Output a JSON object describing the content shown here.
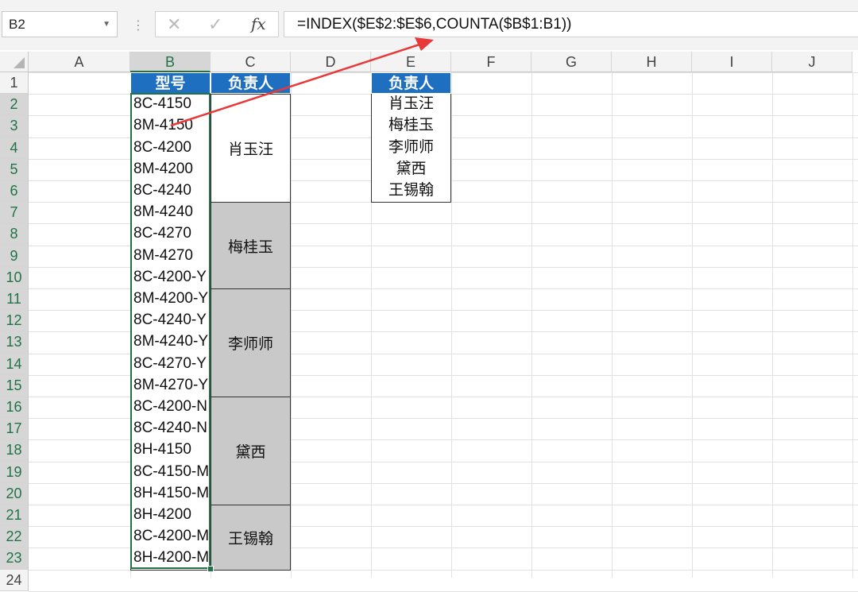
{
  "name_box": {
    "value": "B2",
    "dropdown_icon": "chevron-down-icon"
  },
  "formula_bar": {
    "cancel_icon": "cancel-x-icon",
    "enter_icon": "checkmark-icon",
    "fx_label": "fx",
    "formula": "=INDEX($E$2:$E$6,COUNTA($B$1:B1))"
  },
  "columns": [
    "A",
    "B",
    "C",
    "D",
    "E",
    "F",
    "G",
    "H",
    "I",
    "J"
  ],
  "rows": [
    "1",
    "2",
    "3",
    "4",
    "5",
    "6",
    "7",
    "8",
    "9",
    "10",
    "11",
    "12",
    "13",
    "14",
    "15",
    "16",
    "17",
    "18",
    "19",
    "20",
    "21",
    "22",
    "23",
    "24"
  ],
  "col_a": {
    "header": "型号",
    "values": [
      "8C-4150",
      "8M-4150",
      "8C-4200",
      "8M-4200",
      "8C-4240",
      "8M-4240",
      "8C-4270",
      "8M-4270",
      "8C-4200-Y",
      "8M-4200-Y",
      "8C-4240-Y",
      "8M-4240-Y",
      "8C-4270-Y",
      "8M-4270-Y",
      "8C-4200-N",
      "8C-4240-N",
      "8H-4150",
      "8C-4150-M",
      "8H-4150-M",
      "8H-4200",
      "8C-4200-M",
      "8H-4200-M"
    ]
  },
  "col_b": {
    "header": "负责人",
    "merged": [
      {
        "label": "肖玉汪",
        "rows": 5
      },
      {
        "label": "梅桂玉",
        "rows": 4
      },
      {
        "label": "李师师",
        "rows": 5
      },
      {
        "label": "黛西",
        "rows": 5
      },
      {
        "label": "王锡翰",
        "rows": 3
      }
    ]
  },
  "col_e": {
    "header": "负责人",
    "values": [
      "肖玉汪",
      "梅桂玉",
      "李师师",
      "黛西",
      "王锡翰"
    ]
  },
  "colors": {
    "header_fill": "#1f6fc1",
    "gray_fill": "#c9c9c9",
    "selection": "#217346",
    "arrow": "#e8393a"
  }
}
